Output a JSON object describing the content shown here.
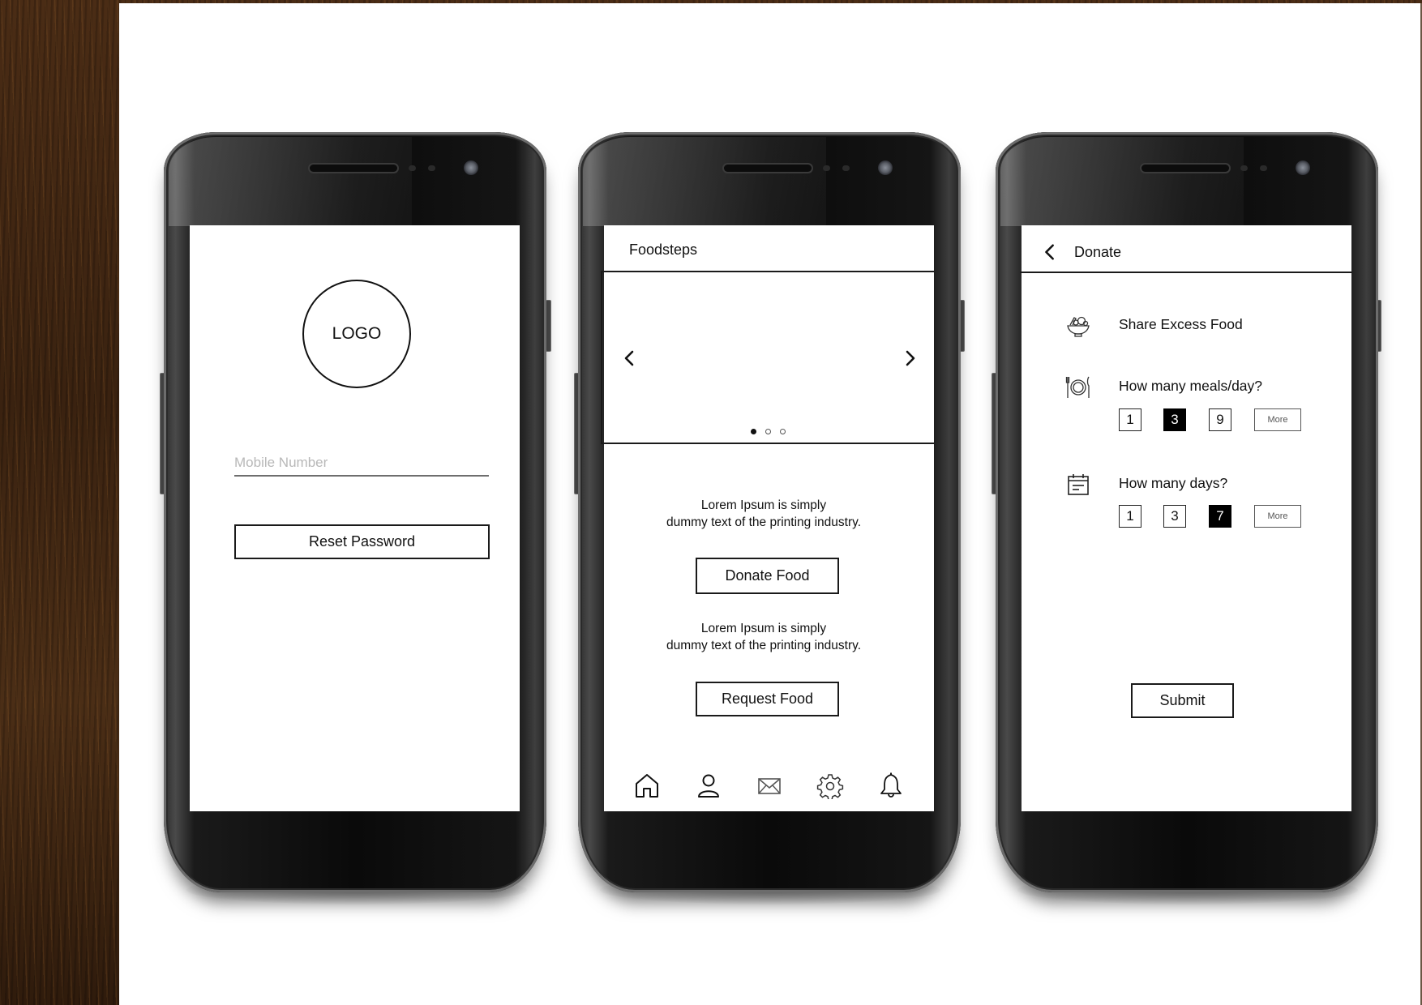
{
  "screens": {
    "reset_password": {
      "logo_label": "LOGO",
      "mobile_input": {
        "placeholder": "Mobile Number",
        "value": ""
      },
      "reset_button_label": "Reset Password"
    },
    "home": {
      "app_title": "Foodsteps",
      "carousel": {
        "prev_icon": "chevron-left-icon",
        "next_icon": "chevron-right-icon",
        "slide_count": 3,
        "active_slide": 1
      },
      "sections": [
        {
          "line1": "Lorem Ipsum is simply",
          "line2": "dummy text of the printing industry.",
          "button_label": "Donate Food"
        },
        {
          "line1": "Lorem Ipsum is simply",
          "line2": "dummy text of the printing industry.",
          "button_label": "Request Food"
        }
      ],
      "bottom_nav": [
        {
          "icon": "home-icon"
        },
        {
          "icon": "user-icon"
        },
        {
          "icon": "mail-icon"
        },
        {
          "icon": "gear-icon"
        },
        {
          "icon": "bell-icon"
        }
      ]
    },
    "donate": {
      "title": "Donate",
      "back_icon": "chevron-left-icon",
      "rows": [
        {
          "icon": "food-bowl-icon",
          "label": "Share Excess Food"
        },
        {
          "icon": "plate-cutlery-icon",
          "label": "How many meals/day?",
          "options": [
            "1",
            "3",
            "9",
            "More"
          ],
          "selected": "3"
        },
        {
          "icon": "calendar-icon",
          "label": "How many days?",
          "options": [
            "1",
            "3",
            "7",
            "More"
          ],
          "selected": "7"
        }
      ],
      "submit_label": "Submit"
    }
  }
}
